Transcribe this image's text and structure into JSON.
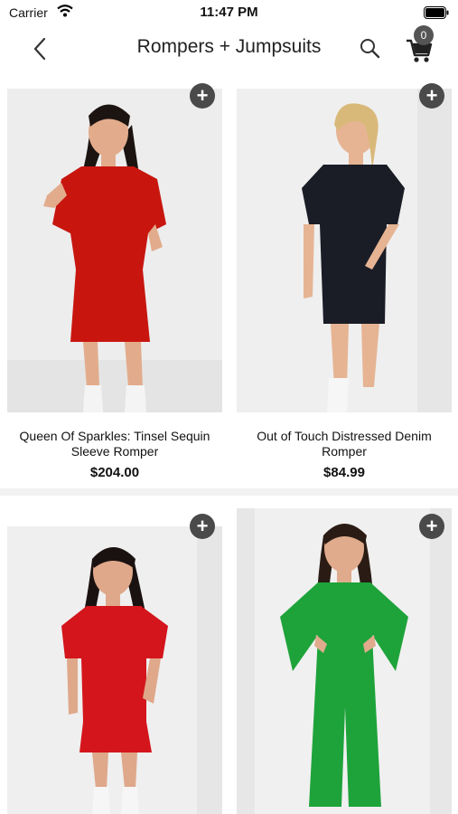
{
  "status_bar": {
    "carrier": "Carrier",
    "time": "11:47 PM"
  },
  "nav": {
    "title": "Rompers + Jumpsuits",
    "cart_count": "0"
  },
  "products": [
    {
      "name": "Queen Of Sparkles: Tinsel Sequin Sleeve Romper",
      "price": "$204.00",
      "add_label": "+",
      "garment_color": "#c8160f",
      "skin_color": "#e2ac8c",
      "hair_color": "#1c1410"
    },
    {
      "name": "Out of Touch Distressed Denim Romper",
      "price": "$84.99",
      "add_label": "+",
      "garment_color": "#1a1d26",
      "skin_color": "#e6b493",
      "hair_color": "#d9b97a"
    },
    {
      "name": "",
      "price": "",
      "add_label": "+",
      "garment_color": "#d4151c",
      "skin_color": "#dfa88a",
      "hair_color": "#1a1210"
    },
    {
      "name": "",
      "price": "",
      "add_label": "+",
      "garment_color": "#1ea33a",
      "skin_color": "#e0ab8c",
      "hair_color": "#2a1c14"
    }
  ]
}
